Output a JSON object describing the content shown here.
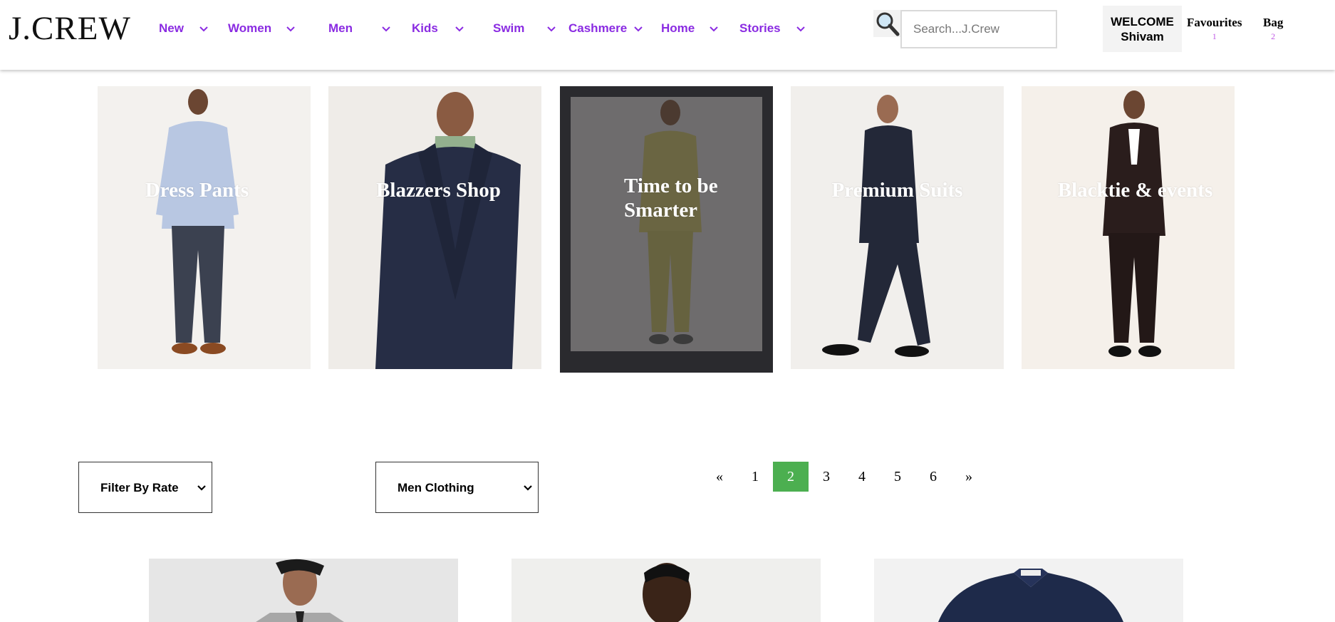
{
  "brand": {
    "logo": "J.CREW"
  },
  "nav": {
    "items": [
      {
        "label": "New"
      },
      {
        "label": "Women"
      },
      {
        "label": "Men"
      },
      {
        "label": "Kids"
      },
      {
        "label": "Swim"
      },
      {
        "label": "Cashmere"
      },
      {
        "label": "Home"
      },
      {
        "label": "Stories"
      }
    ]
  },
  "search": {
    "placeholder": "Search...J.Crew",
    "icon": "magnifying-glass-icon"
  },
  "account": {
    "welcome_line1": "WELCOME",
    "welcome_line2": "Shivam",
    "favourites_label": "Favourites",
    "favourites_count": "1",
    "bag_label": "Bag",
    "bag_count": "2"
  },
  "categories": [
    {
      "label": "Dress Pants"
    },
    {
      "label": "Blazzers Shop"
    },
    {
      "label": "Time to be Smarter"
    },
    {
      "label": "Premium Suits"
    },
    {
      "label": "Blacktie & events"
    }
  ],
  "filters": {
    "rate_label": "Filter By Rate",
    "category_label": "Men Clothing"
  },
  "pagination": {
    "prev": "«",
    "pages": [
      "1",
      "2",
      "3",
      "4",
      "5",
      "6"
    ],
    "active": "2",
    "next": "»"
  },
  "colors": {
    "nav_accent": "#8a2be2",
    "active_page": "#4caf50",
    "count_accent": "#c15ce6"
  }
}
